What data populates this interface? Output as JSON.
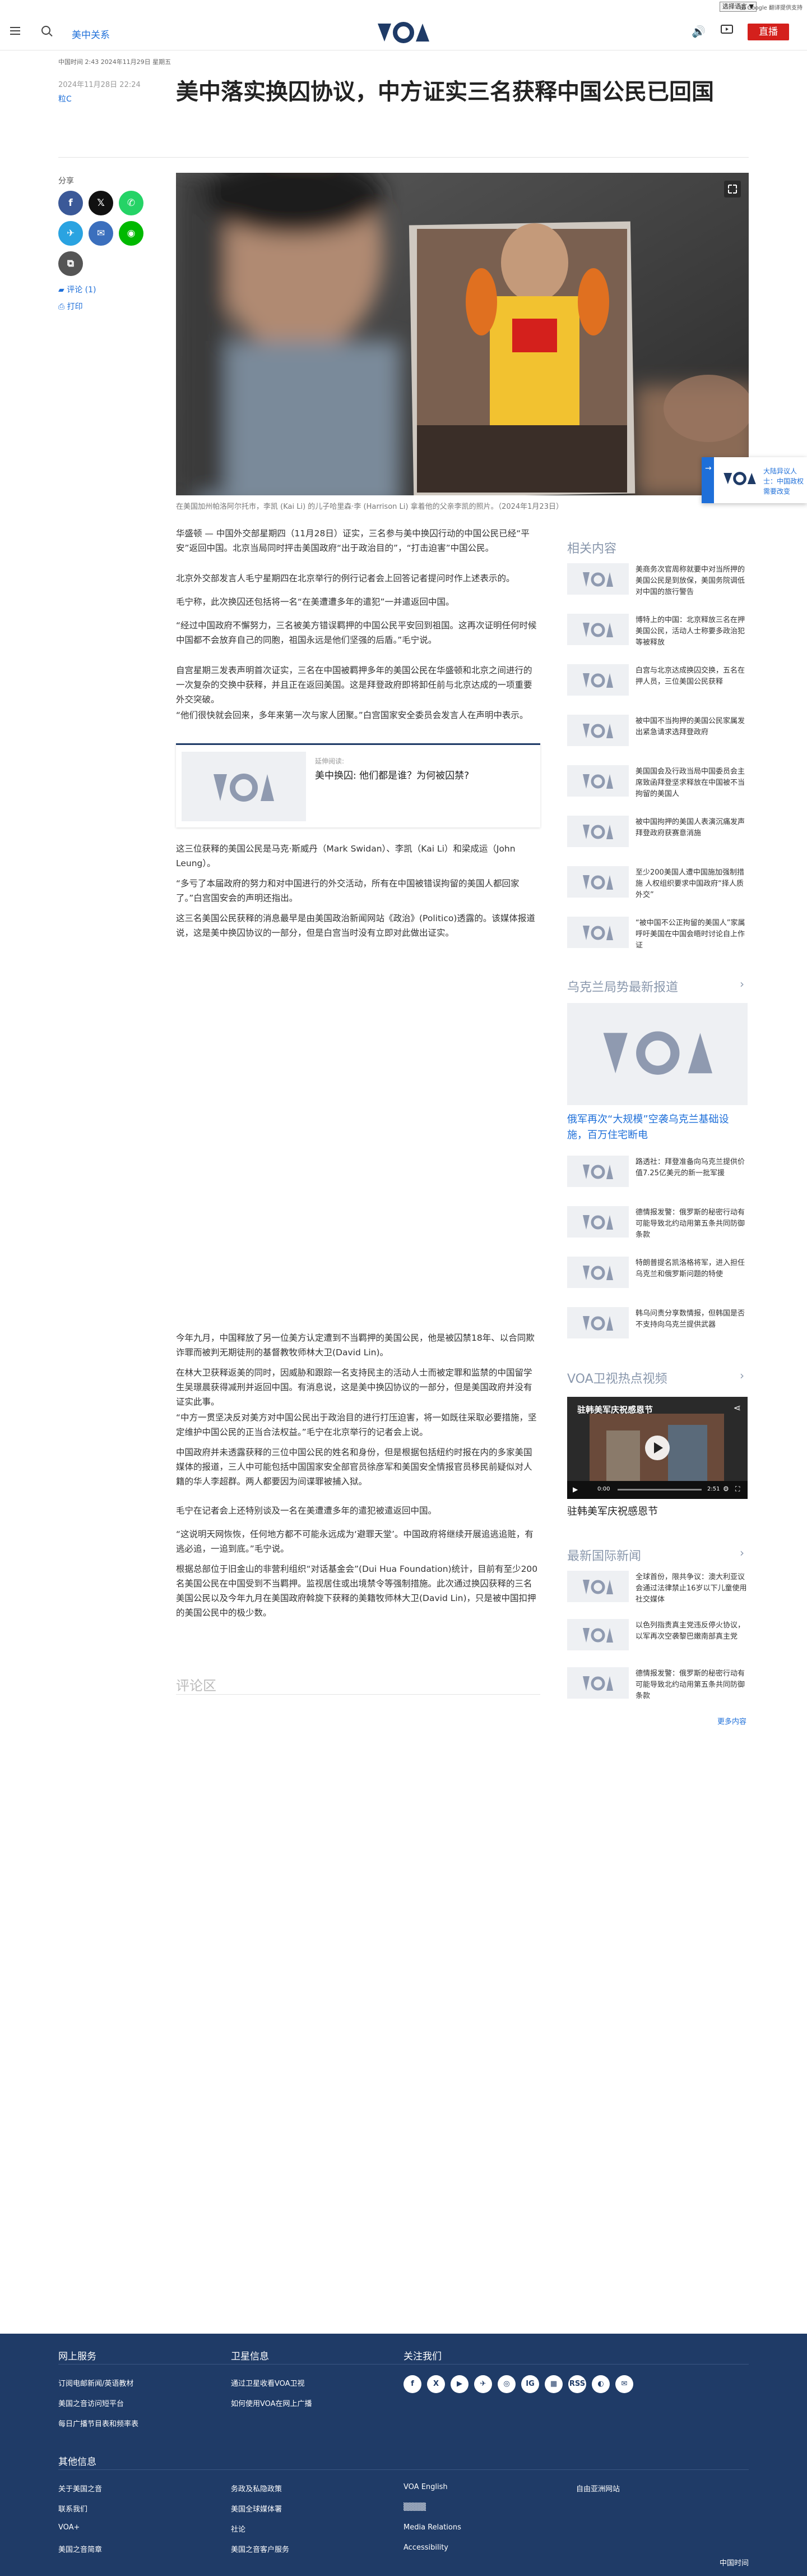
{
  "topbar": {
    "language_select": "选择语言 ▼",
    "google_translate": "由 Google 翻译提供支持"
  },
  "header": {
    "section": "美中关系",
    "logo": "VOA",
    "live_label": "直播"
  },
  "article": {
    "meta": "中国时间 2:43 2024年11月29日 星期五",
    "date": "2024年11月28日 22:24",
    "author": "粒C",
    "title": "美中落实换囚协议，中方证实三名获释中国公民已回国",
    "caption": "在美国加州帕洛阿尔托市，李凯 (Kai Li) 的儿子哈里森·李 (Harrison Li) 拿着他的父亲李凯的照片。（2024年1月23日）",
    "paragraphs": [
      "华盛顿 — 中国外交部星期四（11月28日）证实，三名参与美中换囚行动的中国公民已经“平安”返回中国。北京当局同时抨击美国政府“出于政治目的”，“打击迫害”中国公民。",
      "北京外交部发言人毛宁星期四在北京举行的例行记者会上回答记者提问时作上述表示的。",
      "毛宁称，此次换囚还包括将一名“在美遭遭多年的遣犯”一并遣返回中国。",
      "“经过中国政府不懈努力，三名被美方错误羁押的中国公民平安回到祖国。这再次证明任何时候中国都不会放弃自己的同胞，祖国永远是他们坚强的后盾。”毛宁说。",
      "自宫星期三发表声明首次证实，三名在中国被羁押多年的美国公民在华盛顿和北京之间进行的一次复杂的交换中获释，并且正在返回美国。这是拜登政府即将卸任前与北京达成的一项重要外交突破。",
      "“他们很快就会回来，多年来第一次与家人团聚。”白宫国家安全委员会发言人在声明中表示。"
    ],
    "also_read": {
      "label": "延伸阅读:",
      "title": "美中换囚: 他们都是谁？为何被囚禁?"
    },
    "paragraphs2": [
      "这三位获释的美国公民是马克·斯威丹（Mark Swidan）、李凯（Kai Li）和梁成运（John Leung）。",
      "“多亏了本届政府的努力和对中国进行的外交活动，所有在中国被错误拘留的美国人都回家了。”白宫国安会的声明还指出。",
      "这三名美国公民获释的消息最早是由美国政治新闻网站《政治》(Politico)透露的。该媒体报道说，这是美中换囚协议的一部分，但是白宫当时没有立即对此做出证实。"
    ],
    "paragraphs3": [
      "今年九月，中国释放了另一位美方认定遭到不当羁押的美国公民，他是被囚禁18年、以合同欺诈罪而被判无期徒刑的基督教牧师林大卫(David Lin)。",
      "在林大卫获释返美的同时，因威胁和跟踪一名支持民主的活动人士而被定罪和监禁的中国留学生吴璟晨获得减刑并返回中国。有消息说，这是美中换囚协议的一部分，但是美国政府并没有证实此事。",
      "“中方一贯坚决反对美方对中国公民出于政治目的进行打压迫害，将一如既往采取必要措施，坚定维护中国公民的正当合法权益。”毛宁在北京举行的记者会上说。",
      "中国政府并未透露获释的三位中国公民的姓名和身份，但是根据包括纽约时报在内的多家美国媒体的报道，三人中可能包括中国国家安全部官员徐彦军和美国安全情报官员移民前疑似对人籍的华人李超群。两人都要因为间谍罪被捕入狱。",
      "毛宁在记者会上还特别谈及一名在美遭遭多年的遣犯被遣返回中国。",
      "“这说明天网恢恢，任何地方都不可能永远成为‘避罪天堂’。中国政府将继续开展追逃追赃，有逃必追，一追到底。”毛宁说。",
      "根据总部位于旧金山的非营利组织“对话基金会”(Dui Hua Foundation)统计，目前有至少200名美国公民在中国受到不当羁押。监视居住或出境禁令等强制措施。此次通过换囚获释的三名美国公民以及今年九月在美国政府斡旋下获释的美籍牧师林大卫(David Lin)，只是被中国扣押的美国公民中的极少数。"
    ],
    "comments_label": "评论区"
  },
  "sidebar": {
    "share_label": "分享",
    "comments_link": "评论 (1)",
    "print_link": "打印"
  },
  "rail": {
    "related_title": "相关内容",
    "related_items": [
      "美商务次官周称就要中对当所押的美国公民是到放保，美国务院调低对中国的旅行警告",
      "博特上的中国：北京释放三名在押美国公民，活动人士称要多政治犯等被释放",
      "白宫与北京达成换囚交换，五名在押人员，三位美国公民获释",
      "被中国不当拘押的美国公民家属发出紧急请求选拜登政府",
      "美国国会及行政当局中国委员会主席致函拜登坚求释放在中国被不当拘留的美国人",
      "被中国拘押的美国人表演沉痛发声 拜登政府获赛意消施",
      "至少200美国人遭中国施加强制措施 人权组织要求中国政府“择人质外交”",
      "“被中国不公正拘留的美国人”家属呼吁美国在中国会晤时讨论自上作证"
    ],
    "ukraine_title": "乌克兰局势最新报道",
    "ukraine_headline": "俄军再次“大规模”空袭乌克兰基础设施，百万住宅断电",
    "ukraine_items": [
      "路透社：拜登准备向乌克兰提供价值7.25亿美元的新一批军援",
      "德情报发警：俄罗斯的秘密行动有可能导致北约动用第五条共同防御条款",
      "特朗普提名凯洛格将军，进入担任乌克兰和俄罗斯问题的特使",
      "韩乌问责分享数情报，但韩国是否不支持向乌克兰提供武器"
    ],
    "video_title": "VOA卫视热点视频",
    "video_player_title": "驻韩美军庆祝感恩节",
    "video_time_start": "0:00",
    "video_time_end": "2:51",
    "video_caption": "驻韩美军庆祝感恩节",
    "world_title": "最新国际新闻",
    "world_items": [
      "全球首份，限共争议：澳大利亚议会通过法律禁止16岁以下儿童使用社交媒体",
      "以色列指责真主党违反停火协议，以军再次空袭黎巴嫩南部真主党",
      "德情报发警：俄罗斯的秘密行动有可能导致北约动用第五条共同防御条款"
    ],
    "more_label": "更多内容"
  },
  "floating": {
    "text": "大陆异议人士：中国政权需要改变"
  },
  "footer": {
    "col1_title": "网上服务",
    "col1_links": [
      "订阅电邮新闻/英语教材",
      "美国之音访问短平台",
      "每日广播节目表和频率表"
    ],
    "col2_title": "卫星信息",
    "col2_links": [
      "通过卫星收看VOA卫视",
      "如何使用VOA在网上广播"
    ],
    "col3_title": "关注我们",
    "social": [
      "f",
      "X",
      "▶",
      "✈",
      "◎",
      "IG",
      "▦",
      "RSS",
      "◐",
      "✉"
    ],
    "other_title": "其他信息",
    "other_col1": [
      "关于美国之音",
      "联系我们",
      "VOA+",
      "美国之音简章"
    ],
    "other_col2": [
      "务政及私隐政策",
      "美国全球媒体署",
      "社论",
      "美国之音客户服务"
    ],
    "other_col3": [
      "VOA English",
      "▒▒▒▒",
      "Media Relations",
      "Accessibility"
    ],
    "other_col4": [
      "自由亚洲网站"
    ],
    "bottom_right": "中国时间"
  },
  "colors": {
    "accent": "#1e6fd9",
    "live": "#d4201c",
    "footer": "#1f3b67",
    "facebook": "#3b5998",
    "x": "#111111",
    "whatsapp": "#25d366",
    "telegram": "#2aa3e1",
    "email": "#3b6fbd",
    "line": "#00b900",
    "copy": "#555555"
  }
}
